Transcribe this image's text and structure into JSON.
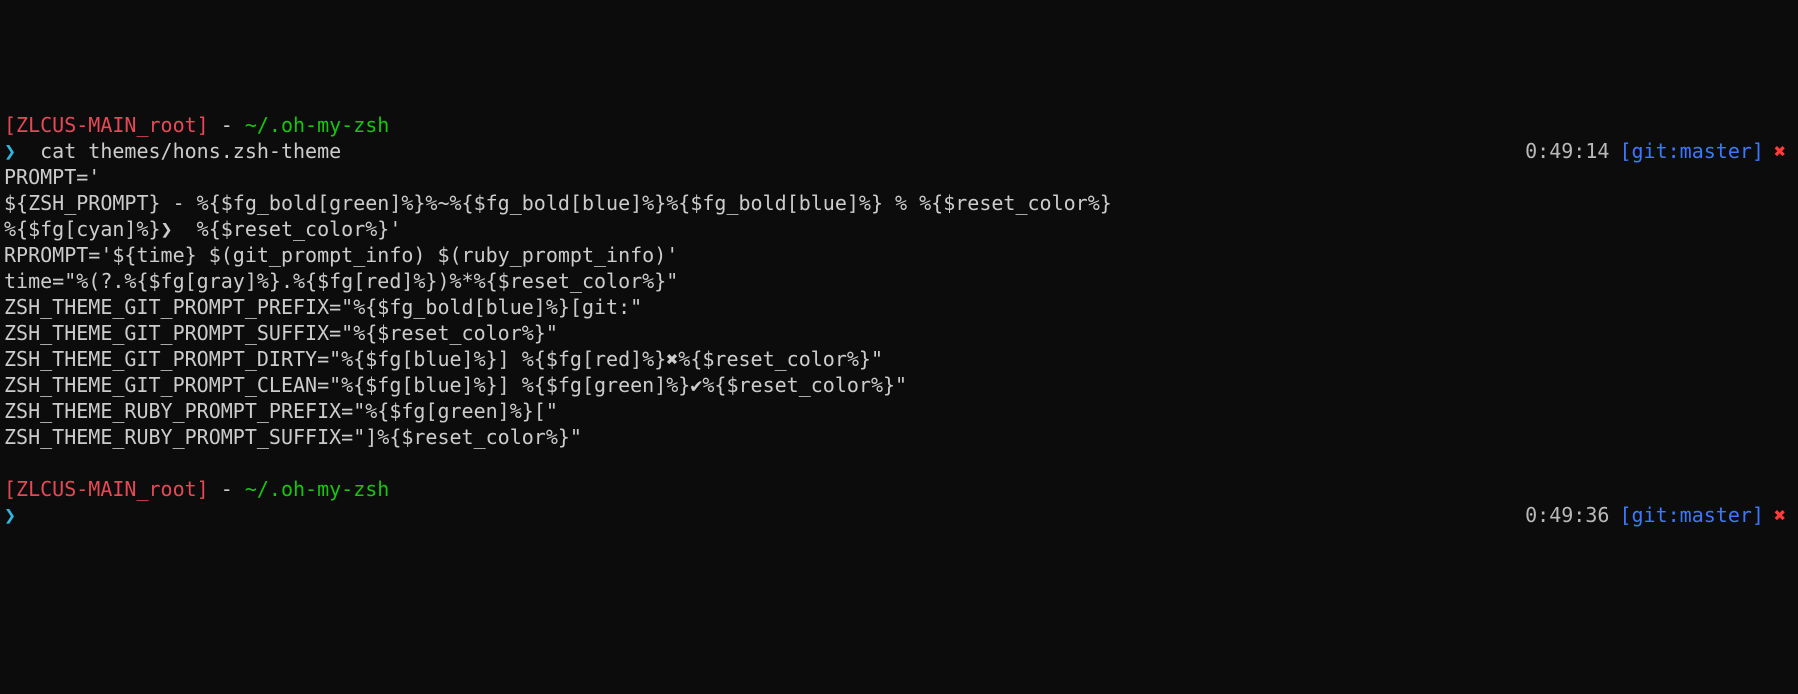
{
  "prompt1": {
    "host": "[ZLCUS-MAIN_root]",
    "sep": " - ",
    "path": "~/.oh-my-zsh",
    "arrow": "❯",
    "command": "  cat themes/hons.zsh-theme",
    "time": "0:49:14",
    "git_open": "[",
    "git_label": "git:",
    "git_branch": "master",
    "git_close": "]",
    "dirty": "✖"
  },
  "file": {
    "l1": "PROMPT='",
    "l2": "${ZSH_PROMPT} - %{$fg_bold[green]%}%~%{$fg_bold[blue]%}%{$fg_bold[blue]%} % %{$reset_color%}",
    "l3": "%{$fg[cyan]%}❯  %{$reset_color%}'",
    "l4": "",
    "l5": "RPROMPT='${time} $(git_prompt_info) $(ruby_prompt_info)'",
    "l6": "",
    "l7": "time=\"%(?.%{$fg[gray]%}.%{$fg[red]%})%*%{$reset_color%}\"",
    "l8": "",
    "l9": "ZSH_THEME_GIT_PROMPT_PREFIX=\"%{$fg_bold[blue]%}[git:\"",
    "l10": "ZSH_THEME_GIT_PROMPT_SUFFIX=\"%{$reset_color%}\"",
    "l11": "ZSH_THEME_GIT_PROMPT_DIRTY=\"%{$fg[blue]%}] %{$fg[red]%}✖%{$reset_color%}\"",
    "l12": "ZSH_THEME_GIT_PROMPT_CLEAN=\"%{$fg[blue]%}] %{$fg[green]%}✔%{$reset_color%}\"",
    "l13": "ZSH_THEME_RUBY_PROMPT_PREFIX=\"%{$fg[green]%}[\"",
    "l14": "ZSH_THEME_RUBY_PROMPT_SUFFIX=\"]%{$reset_color%}\""
  },
  "prompt2": {
    "host": "[ZLCUS-MAIN_root]",
    "sep": " - ",
    "path": "~/.oh-my-zsh",
    "arrow": "❯",
    "time": "0:49:36",
    "git_open": "[",
    "git_label": "git:",
    "git_branch": "master",
    "git_close": "]",
    "dirty": "✖"
  }
}
